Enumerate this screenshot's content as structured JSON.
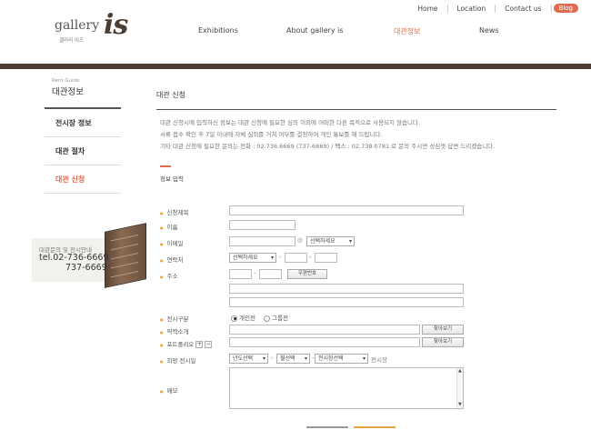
{
  "topnav": {
    "home": "Home",
    "location": "Location",
    "contact": "Contact us",
    "blog": "Blog"
  },
  "logo": {
    "gallery": "gallery",
    "korean": "갤러리 이즈",
    "is": "is"
  },
  "mainnav": {
    "exhibitions": "Exhibitions",
    "about": "About gallery is",
    "rental": "대관정보",
    "news": "News"
  },
  "sidebar": {
    "title_en": "Rent Guide",
    "title_ko": "대관정보",
    "items": [
      {
        "label": "전시장 정보"
      },
      {
        "label": "대관 절차"
      },
      {
        "label": "대관 신청"
      }
    ],
    "contact": {
      "caption": "대관문의 및 전시안내",
      "tel1": "tel.02-736-6669",
      "tel2": "737-6669"
    }
  },
  "content": {
    "title": "대관 신청",
    "info": [
      "대관 신청시에 입력하신 정보는 대관 신청에 필요한 심의 이외에 어떠한 다른 목적으로 사용되지 않습니다.",
      "서류 접수 확인 후 7일 이내에 자체 심의를 거쳐 여부를 결정하여 개인 통보를 해 드립니다.",
      "기타 대관 신청에 필요한 문의는 전화 : 02.736.6669 (737-6669) / 팩스 : 02.738.0781 로 문의 주시면 성심껏 답변 드리겠습니다."
    ],
    "section": "정보 입력"
  },
  "form": {
    "title_label": "신청제목",
    "name_label": "이름",
    "email_label": "이메일",
    "email_select": "선택하세요",
    "phone_label": "연락처",
    "phone_select": "선택하세요",
    "address_label": "주소",
    "zip_button": "우편번호",
    "exhibit_type_label": "전시구분",
    "radio_individual": "개인전",
    "radio_group": "그룹전",
    "career_label": "약력소개",
    "browse1": "찾아보기",
    "portfolio_label": "포트폴리오",
    "plus": "+",
    "minus": "−",
    "browse2": "찾아보기",
    "date_label": "희망 전시일",
    "year_select": "년도선택",
    "month_select": "월선택",
    "hall_select": "전시장선택",
    "hall_suffix": "전시장",
    "memo_label": "메모"
  },
  "colors": {
    "accent": "#e36b4d",
    "bar": "#4a3c33",
    "bullet": "#e3a33a"
  }
}
